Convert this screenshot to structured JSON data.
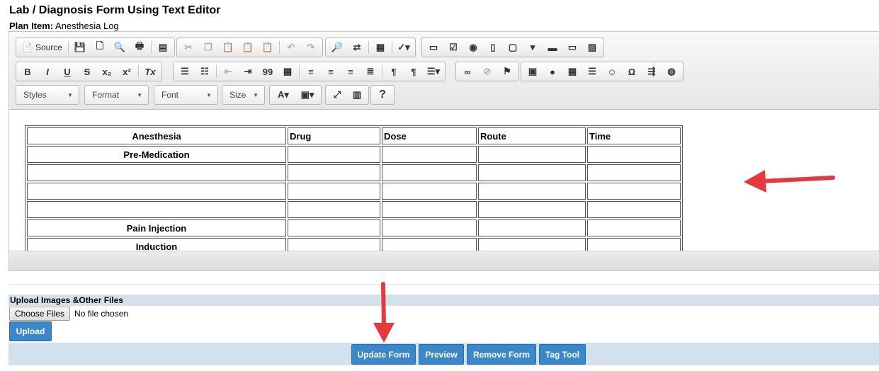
{
  "page": {
    "title": "Lab / Diagnosis Form Using Text Editor",
    "plan_item_label": "Plan Item:",
    "plan_item_value": "Anesthesia Log"
  },
  "toolbar": {
    "source_label": "Source",
    "combos": {
      "styles": "Styles",
      "format": "Format",
      "font": "Font",
      "size": "Size"
    },
    "glyphs": {
      "bold": "B",
      "italic": "I",
      "underline": "U",
      "strike": "S",
      "subscript": "x₂",
      "superscript": "x²",
      "remove_format": "Tx",
      "blockquote": "99",
      "help": "?",
      "special_char": "Ω"
    }
  },
  "table": {
    "headers": [
      "Anesthesia",
      "Drug",
      "Dose",
      "Route",
      "Time"
    ],
    "rows": [
      [
        "Pre-Medication",
        "",
        "",
        "",
        ""
      ],
      [
        "",
        "",
        "",
        "",
        ""
      ],
      [
        "",
        "",
        "",
        "",
        ""
      ],
      [
        "",
        "",
        "",
        "",
        ""
      ],
      [
        "Pain Injection",
        "",
        "",
        "",
        ""
      ],
      [
        "Induction",
        "",
        "",
        "",
        ""
      ]
    ]
  },
  "upload": {
    "header": "Upload Images &Other Files",
    "choose_label": "Choose Files",
    "no_file_text": "No file chosen",
    "upload_label": "Upload"
  },
  "actions": {
    "update": "Update Form",
    "preview": "Preview",
    "remove": "Remove Form",
    "tag": "Tag Tool"
  },
  "colors": {
    "primary_button": "#3a87c9",
    "bar_background": "#d3e1ec",
    "annotation_arrow": "#e8383d"
  }
}
